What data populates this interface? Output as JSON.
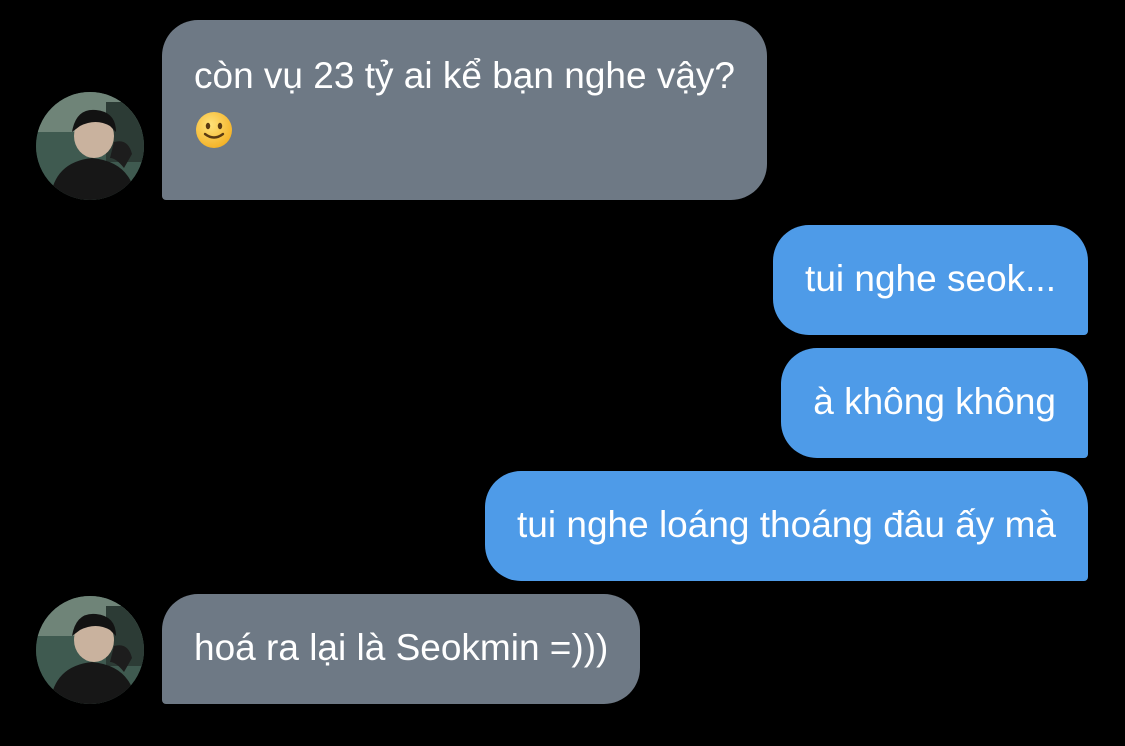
{
  "conversation": {
    "messages": [
      {
        "direction": "incoming",
        "text": "còn vụ 23 tỷ ai kể bạn nghe vậy?",
        "emoji": "slightly-smiling-face-emoji"
      },
      {
        "direction": "outgoing",
        "text": "tui nghe seok..."
      },
      {
        "direction": "outgoing",
        "text": "à không không"
      },
      {
        "direction": "outgoing",
        "text": "tui nghe loáng thoáng đâu ấy mà"
      },
      {
        "direction": "incoming",
        "text": "hoá ra lại là Seokmin =)))"
      }
    ]
  },
  "colors": {
    "background": "#000000",
    "incoming_bubble": "#6e7985",
    "outgoing_bubble": "#4e9be8",
    "text": "#ffffff"
  }
}
